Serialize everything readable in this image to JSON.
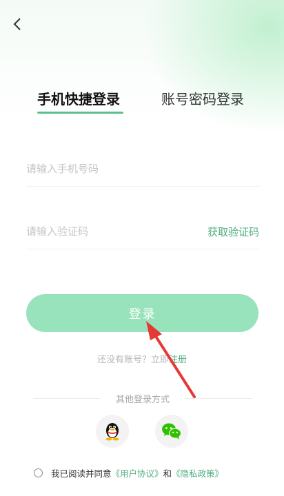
{
  "header": {
    "back_icon": "chevron-left-icon"
  },
  "tabs": [
    {
      "label": "手机快捷登录",
      "active": true
    },
    {
      "label": "账号密码登录",
      "active": false
    }
  ],
  "form": {
    "phone_placeholder": "请输入手机号码",
    "code_placeholder": "请输入验证码",
    "get_code_label": "获取验证码",
    "login_label": "登录"
  },
  "register": {
    "prompt": "还没有账号？立即",
    "link": "注册"
  },
  "other_login": {
    "label": "其他登录方式",
    "methods": [
      "qq-icon",
      "wechat-icon"
    ]
  },
  "agreement": {
    "prefix": "我已阅读并同意",
    "user_agreement": "《用户协议》",
    "and": "和",
    "privacy_policy": "《隐私政策》"
  },
  "colors": {
    "accent": "#4fae80",
    "button": "#98e3bc",
    "annotation_arrow": "#e53935"
  }
}
